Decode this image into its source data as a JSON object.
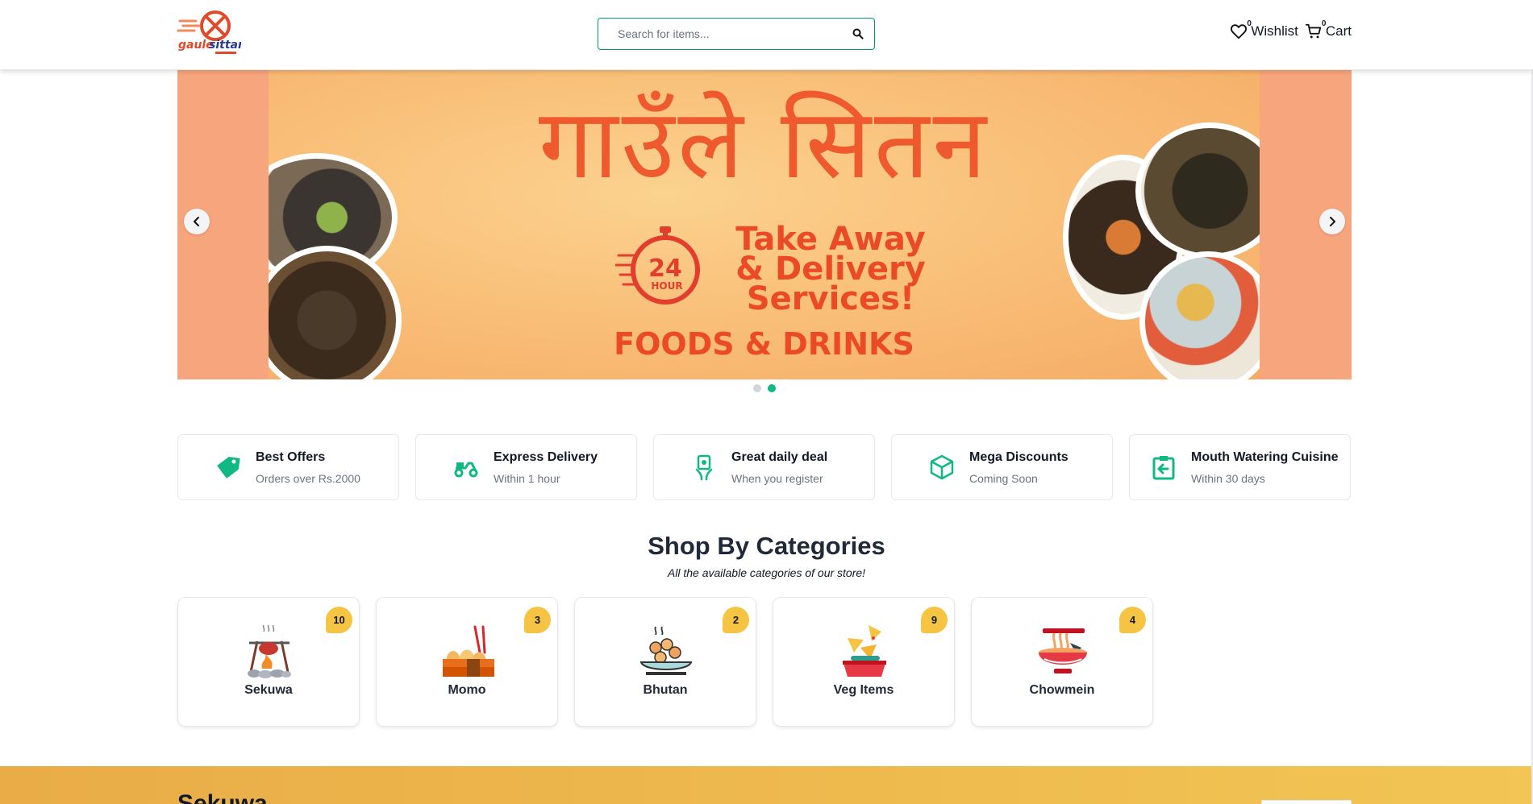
{
  "header": {
    "logo_text": "gaulesittan",
    "search_placeholder": "Search for items...",
    "wishlist": {
      "label": "Wishlist",
      "count": "0"
    },
    "cart": {
      "label": "Cart",
      "count": "0"
    }
  },
  "banner": {
    "title": "गाउँले सितन",
    "clock_number": "24",
    "clock_unit": "HOUR",
    "subtitle_lines": [
      "Take Away",
      "& Delivery",
      "Services!"
    ],
    "subtitle_1": "Take Away",
    "subtitle_2": "& Delivery",
    "subtitle_3": "Services!",
    "tagline": "FOODS & DRINKS",
    "active_slide": 2,
    "slide_count": 2
  },
  "features": [
    {
      "title": "Best Offers",
      "subtitle": "Orders over Rs.2000",
      "icon": "tag-icon"
    },
    {
      "title": "Express Delivery",
      "subtitle": "Within 1 hour",
      "icon": "scooter-icon"
    },
    {
      "title": "Great daily deal",
      "subtitle": "When you register",
      "icon": "money-hand-icon"
    },
    {
      "title": "Mega Discounts",
      "subtitle": "Coming Soon",
      "icon": "box-icon"
    },
    {
      "title": "Mouth Watering Cuisine",
      "subtitle": "Within 30 days",
      "icon": "return-icon"
    }
  ],
  "categories_section": {
    "heading": "Shop By Categories",
    "subheading": "All the available categories of our store!",
    "items": [
      {
        "name": "Sekuwa",
        "count": "10",
        "icon": "sekuwa-grill-icon"
      },
      {
        "name": "Momo",
        "count": "3",
        "icon": "momo-icon"
      },
      {
        "name": "Bhutan",
        "count": "2",
        "icon": "bhutan-dish-icon"
      },
      {
        "name": "Veg Items",
        "count": "9",
        "icon": "veg-nachos-icon"
      },
      {
        "name": "Chowmein",
        "count": "4",
        "icon": "noodle-bowl-icon"
      }
    ]
  },
  "bottom_section": {
    "title": "Sekuwa"
  },
  "colors": {
    "accent": "#10b981",
    "badge": "#f6c443",
    "banner": "#f7a57c",
    "banner_text": "#ea4a26"
  }
}
